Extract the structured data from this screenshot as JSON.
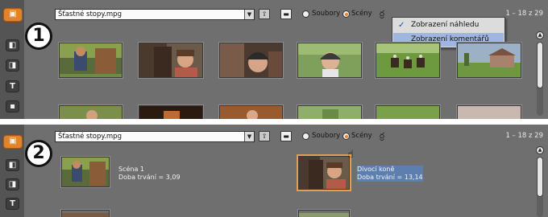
{
  "accent_color": "#e0842c",
  "panels": [
    {
      "step": "1",
      "file_name": "Šťastné stopy.mpg",
      "radio_files": "Soubory",
      "radio_scenes": "Scény",
      "counter": "1 – 18 z 29",
      "view_menu": {
        "items": [
          {
            "label": "Zobrazení náhledu",
            "checked": true
          },
          {
            "label": "Zobrazení komentářů",
            "checked": false
          }
        ]
      },
      "thumbnails": [
        {
          "name": "boy-with-horse"
        },
        {
          "name": "horse-and-girl"
        },
        {
          "name": "boy-in-helmet"
        },
        {
          "name": "rider-in-helmet"
        },
        {
          "name": "riders-in-field"
        },
        {
          "name": "farmhouse"
        }
      ]
    },
    {
      "step": "2",
      "file_name": "Šťastné stopy.mpg",
      "radio_files": "Soubory",
      "radio_scenes": "Scény",
      "counter": "1 – 18 z 29",
      "clips": [
        {
          "title": "Scéna 1",
          "duration": "Doba trvání = 3,09"
        },
        {
          "title": "Divocí koně",
          "duration": "Doba trvání = 13,14"
        }
      ]
    }
  ],
  "sidebar_icons": [
    "album-icon",
    "video-effects-icon",
    "transitions-icon",
    "titles-icon",
    "still-images-icon"
  ]
}
